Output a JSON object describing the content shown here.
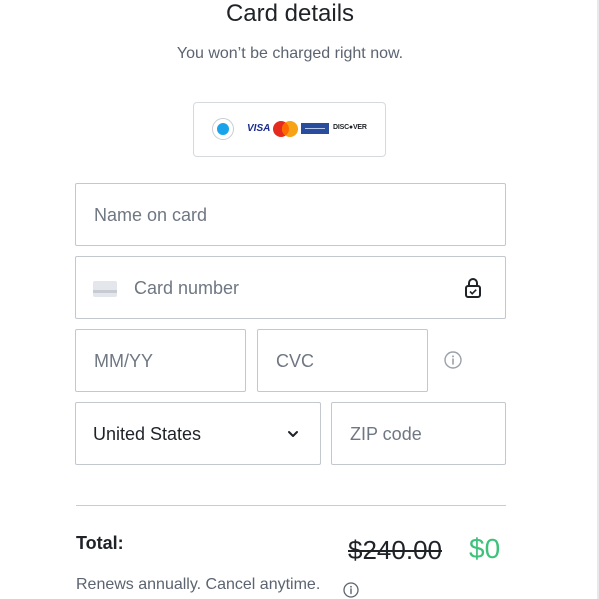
{
  "header": {
    "title": "Card details",
    "subtitle": "You won’t be charged right now."
  },
  "payment_method": {
    "selected": true,
    "brands": [
      "VISA",
      "Mastercard",
      "AMEX",
      "DISCOVER"
    ],
    "visa_text": "VISA",
    "discover_text": "DISC●VER",
    "accent_color": "#1aa3e8"
  },
  "form": {
    "name_on_card": {
      "placeholder": "Name on card",
      "value": ""
    },
    "card_number": {
      "placeholder": "Card number",
      "value": ""
    },
    "expiry": {
      "placeholder": "MM/YY",
      "value": ""
    },
    "cvc": {
      "placeholder": "CVC",
      "value": ""
    },
    "country": {
      "value": "United States"
    },
    "zip": {
      "placeholder": "ZIP code",
      "value": ""
    }
  },
  "summary": {
    "total_label": "Total:",
    "original_price": "$240.00",
    "price": "$0",
    "price_color": "#3ec27b",
    "renew_text": "Renews annually. Cancel anytime."
  },
  "icons": {
    "card": "credit-card-icon",
    "lock": "lock-icon",
    "cvc_info": "info-icon",
    "country_dropdown": "chevron-down-icon",
    "renew_info": "info-icon"
  }
}
